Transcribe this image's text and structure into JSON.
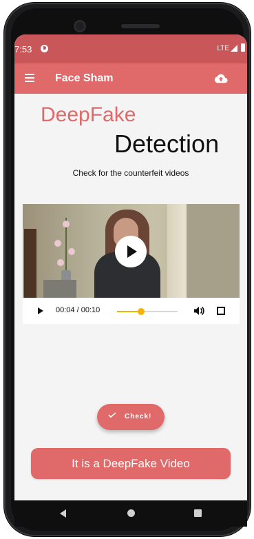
{
  "status_bar": {
    "time": "7:53",
    "network": "LTE",
    "icons": [
      "app-notification-icon",
      "signal-icon",
      "battery-icon"
    ]
  },
  "app_bar": {
    "title": "Face Sham",
    "menu_icon": "menu-icon",
    "action_icon": "cloud-upload-icon"
  },
  "header": {
    "title_part1": "DeepFake",
    "title_part2": "Detection",
    "subtitle": "Check for the counterfeit videos"
  },
  "video_player": {
    "current_time": "00:04",
    "duration": "00:10",
    "time_display": "00:04 / 00:10",
    "progress": 0.4,
    "icons": [
      "play-icon",
      "volume-icon",
      "fullscreen-icon"
    ]
  },
  "actions": {
    "check_label": "Check!",
    "result_label": "It is a DeepFake Video"
  },
  "colors": {
    "accent": "#e06a6a",
    "status_bar": "#c9575a",
    "seek": "#f4b400",
    "background": "#f4f4f4"
  },
  "navigation": {
    "icons": [
      "back-icon",
      "home-icon",
      "recents-icon"
    ]
  }
}
